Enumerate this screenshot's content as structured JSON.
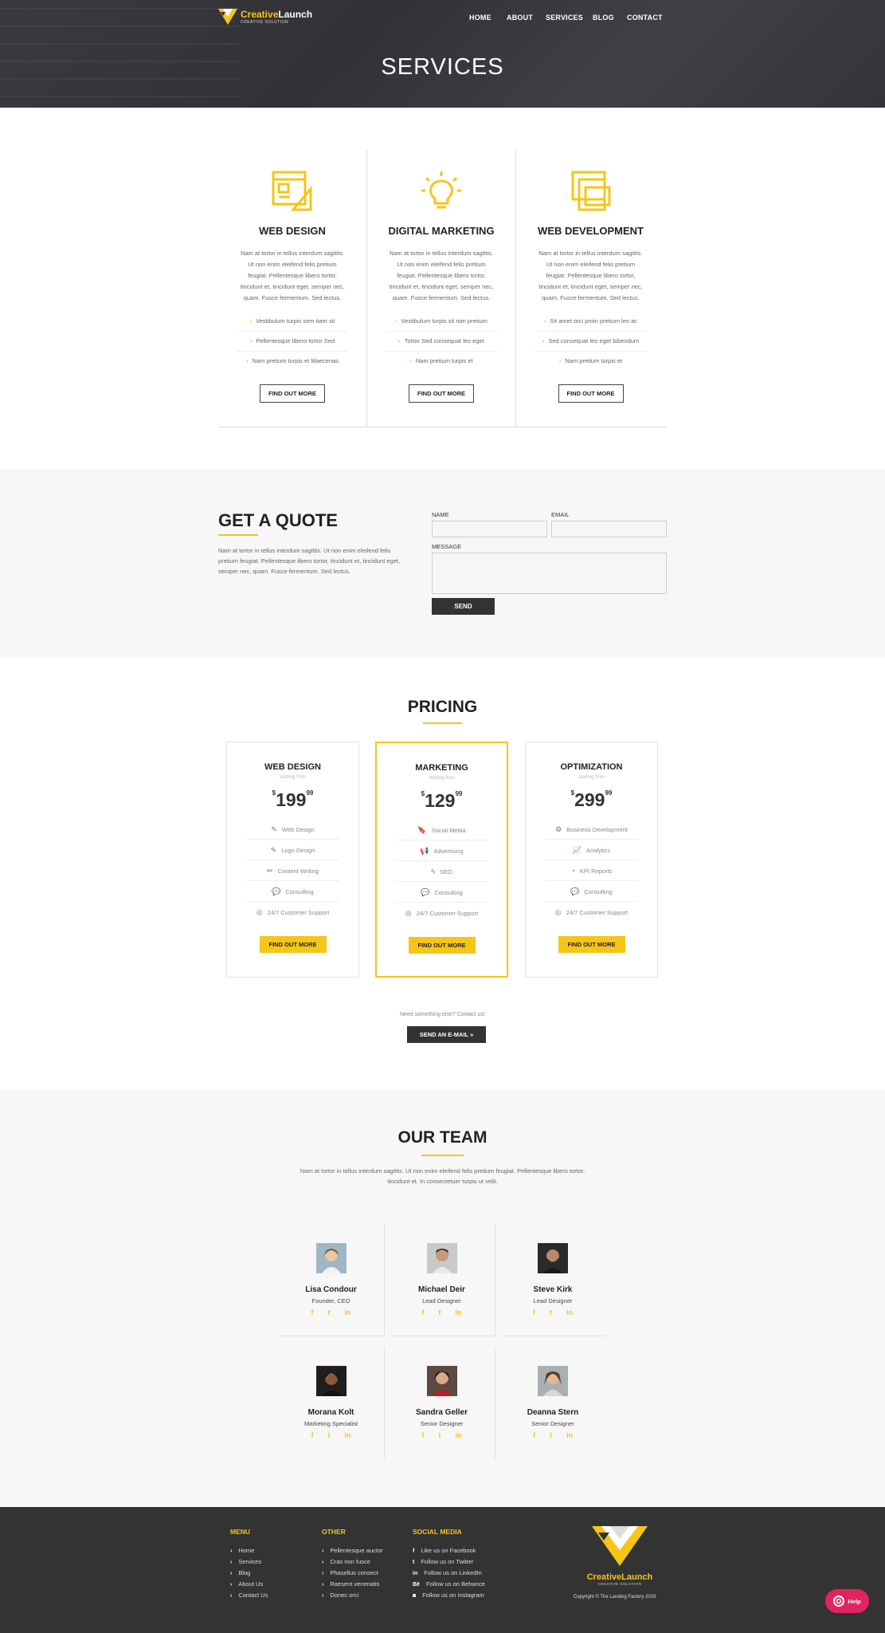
{
  "brand": {
    "name_a": "Creative",
    "name_b": "Launch",
    "tagline": "CREATIVE SOLUTION",
    "accent": "#f5c518",
    "dark": "#333333"
  },
  "nav": [
    {
      "label": "HOME"
    },
    {
      "label": "ABOUT"
    },
    {
      "label": "SERVICES"
    },
    {
      "label": "BLOG"
    },
    {
      "label": "CONTACT"
    }
  ],
  "hero": {
    "title": "SERVICES"
  },
  "services": [
    {
      "icon": "web-design-icon",
      "title": "WEB DESIGN",
      "text": "Nam at tortor in tellus interdum sagittis. Ut non enim eleifend felis pretium feugiat. Pellentesque libero tortor, tincidunt et, tincidunt eget, semper nec, quam. Fusce fermentum. Sed lectus.",
      "items": [
        "Vestibulum turpis sem tiam sit",
        "Pellentesque libero tortor Sed",
        "Nam pretium turpis et Maecenas"
      ],
      "button": "FIND OUT MORE"
    },
    {
      "icon": "lightbulb-icon",
      "title": "DIGITAL MARKETING",
      "text": "Nam at tortor in tellus interdum sagittis. Ut non enim eleifend felis pretium feugiat. Pellentesque libero tortor, tincidunt et, tincidunt eget, semper nec, quam. Fusce fermentum. Sed lectus.",
      "items": [
        "Vestibulum turpis sit roin pretium",
        "Tortor Sed consequat leo eget",
        "Nam pretium turpis et"
      ],
      "button": "FIND OUT MORE"
    },
    {
      "icon": "devices-icon",
      "title": "WEB DEVELOPMENT",
      "text": "Nam at tortor in tellus interdum sagittis. Ut non enim eleifend felis pretium feugiat. Pellentesque libero tortor, tincidunt et, tincidunt eget, semper nec, quam. Fusce fermentum. Sed lectus.",
      "items": [
        "Sit amet orci proin pretium leo ac",
        "Sed consequat leo eget bibendum",
        "Nam pretium turpis et"
      ],
      "button": "FIND OUT MORE"
    }
  ],
  "quote": {
    "title": "GET A QUOTE",
    "text": "Nam at tortor in tellus interdum sagittis. Ut non enim eleifend felis pretium feugiat. Pellentesque libero tortor, tincidunt et, tincidunt eget, semper nec, quam. Fusce fermentum. Sed lectus.",
    "name_label": "NAME",
    "email_label": "EMAIL",
    "message_label": "MESSAGE",
    "send": "SEND"
  },
  "pricing": {
    "title": "PRICING",
    "plans": [
      {
        "name": "WEB DESIGN",
        "starting": "starting from",
        "currency": "$",
        "price": "199",
        "cents": "99",
        "features": [
          {
            "icon": "✎",
            "label": "Web Design"
          },
          {
            "icon": "✎",
            "label": "Logo Design"
          },
          {
            "icon": "✏",
            "label": "Content Writing"
          },
          {
            "icon": "💬",
            "label": "Consulting"
          },
          {
            "icon": "◎",
            "label": "24/7 Customer Support"
          }
        ],
        "button": "FIND OUT MORE"
      },
      {
        "name": "MARKETING",
        "starting": "starting from",
        "currency": "$",
        "price": "129",
        "cents": "99",
        "features": [
          {
            "icon": "🔖",
            "label": "Social Media"
          },
          {
            "icon": "📢",
            "label": "Advertising"
          },
          {
            "icon": "ϟ",
            "label": "SEO"
          },
          {
            "icon": "💬",
            "label": "Consulting"
          },
          {
            "icon": "◎",
            "label": "24/7 Customer Support"
          }
        ],
        "button": "FIND OUT MORE"
      },
      {
        "name": "OPTIMIZATION",
        "starting": "starting from",
        "currency": "$",
        "price": "299",
        "cents": "99",
        "features": [
          {
            "icon": "⚙",
            "label": "Business Development"
          },
          {
            "icon": "📈",
            "label": "Analytics"
          },
          {
            "icon": "◔",
            "label": "KPI Reports"
          },
          {
            "icon": "💬",
            "label": "Consulting"
          },
          {
            "icon": "◎",
            "label": "24/7 Customer Support"
          }
        ],
        "button": "FIND OUT MORE"
      }
    ],
    "need": "Need something else? Contact us!",
    "email_button": "SEND AN E-MAIL »"
  },
  "team": {
    "title": "OUR TEAM",
    "intro": "Nam at tortor in tellus interdum sagittis. Ut non enim eleifend felis pretium feugiat. Pellentesque libero tortor, tincidunt et. In consectetuer turpis ut velit.",
    "members": [
      {
        "name": "Lisa Condour",
        "role": "Founder, CEO"
      },
      {
        "name": "Michael Deir",
        "role": "Lead Designer"
      },
      {
        "name": "Steve Kirk",
        "role": "Lead Designer"
      },
      {
        "name": "Morana Kolt",
        "role": "Marketing Specialist"
      },
      {
        "name": "Sandra Geller",
        "role": "Senior Designer"
      },
      {
        "name": "Deanna Stern",
        "role": "Senior Designer"
      }
    ],
    "social": [
      "f",
      "t",
      "in"
    ]
  },
  "footer": {
    "menu": {
      "title": "MENU",
      "items": [
        "Home",
        "Services",
        "Blog",
        "About Us",
        "Contact Us"
      ]
    },
    "other": {
      "title": "OTHER",
      "items": [
        "Pellentesque auctor",
        "Cras non fusce",
        "Phasellus consect",
        "Raesent venenatis",
        "Donec orci"
      ]
    },
    "social": {
      "title": "SOCIAL MEDIA",
      "items": [
        "Like us on Facebook",
        "Follow us on Twitter",
        "Follow us on LinkedIn",
        "Follow us on Behance",
        "Follow us on Instagram"
      ]
    },
    "copyright": "Copyright © The Landing Factory 2019"
  },
  "help": {
    "label": "Help"
  }
}
